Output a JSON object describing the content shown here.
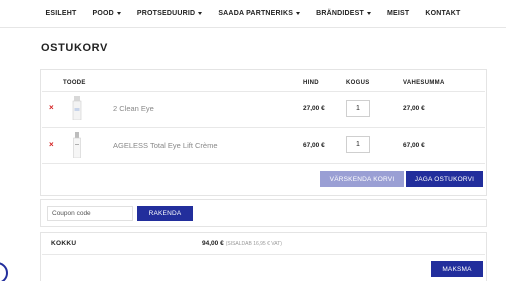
{
  "nav": [
    {
      "label": "ESILEHT",
      "dropdown": false
    },
    {
      "label": "POOD",
      "dropdown": true
    },
    {
      "label": "PROTSEDUURID",
      "dropdown": true
    },
    {
      "label": "SAADA PARTNERIKS",
      "dropdown": true
    },
    {
      "label": "BRÄNDIDEST",
      "dropdown": true
    },
    {
      "label": "MEIST",
      "dropdown": false
    },
    {
      "label": "KONTAKT",
      "dropdown": false
    }
  ],
  "page": {
    "title": "OSTUKORV"
  },
  "table": {
    "headers": {
      "product": "TOODE",
      "price": "HIND",
      "quantity": "KOGUS",
      "subtotal": "VAHESUMMA"
    },
    "rows": [
      {
        "remove": "×",
        "name": "2 Clean Eye",
        "price": "27,00 €",
        "quantity": "1",
        "subtotal": "27,00 €"
      },
      {
        "remove": "×",
        "name": "AGELESS Total Eye Lift Crème",
        "price": "67,00 €",
        "quantity": "1",
        "subtotal": "67,00 €"
      }
    ]
  },
  "actions": {
    "update_cart": "VÄRSKENDA KORVI",
    "share_cart": "JAGA OSTUKORVI"
  },
  "coupon": {
    "placeholder": "Coupon code",
    "apply": "RAKENDA"
  },
  "totals": {
    "label": "KOKKU",
    "value": "94,00 €",
    "vat_note": "(SISALDAB 16,95 € VAT)"
  },
  "checkout": {
    "label": "MAKSMA"
  },
  "colors": {
    "primary": "#222e9c",
    "primary_light": "#9a9fd4",
    "remove": "#d32020"
  }
}
